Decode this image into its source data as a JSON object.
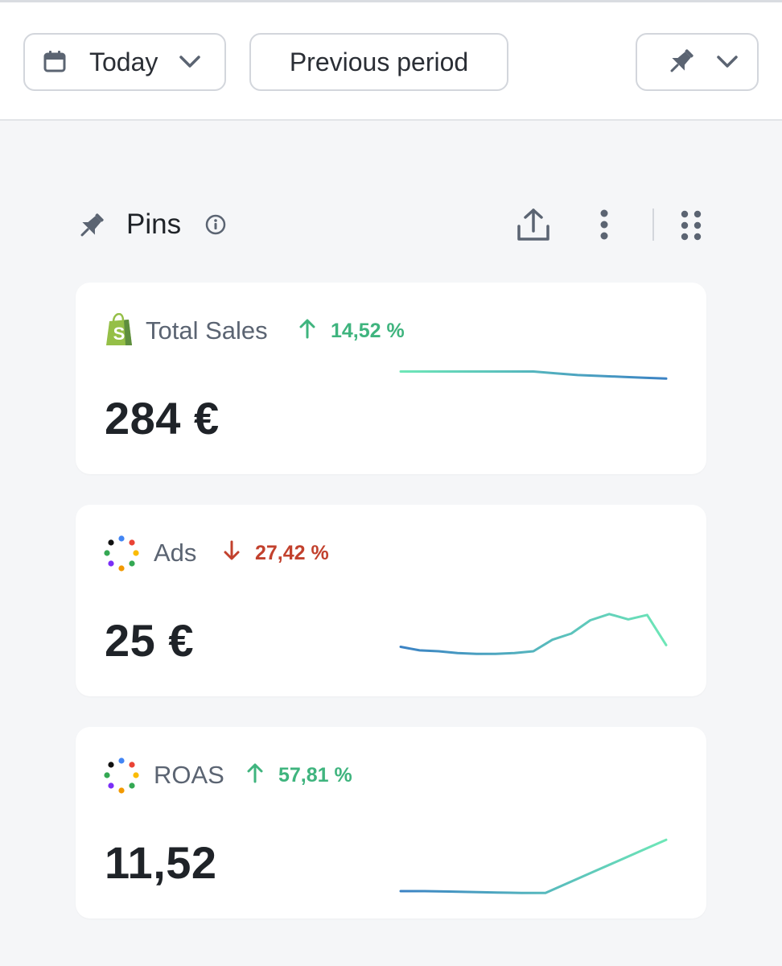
{
  "toolbar": {
    "date_label": "Today",
    "compare_label": "Previous period"
  },
  "section": {
    "title": "Pins"
  },
  "cards": [
    {
      "name": "Total Sales",
      "change": "14,52 %",
      "trend": "up",
      "value": "284 €",
      "icon": "shopify-icon",
      "sparkline": [
        0.95,
        0.95,
        0.95,
        0.95,
        0.95,
        0.95,
        0.95,
        0.93,
        0.91,
        0.9,
        0.89,
        0.88,
        0.87
      ],
      "colors": [
        "#6ee7b7",
        "#3b82c4"
      ]
    },
    {
      "name": "Ads",
      "change": "27,42 %",
      "trend": "down",
      "value": "25 €",
      "icon": "ads-dots-icon",
      "sparkline": [
        0.35,
        0.31,
        0.3,
        0.28,
        0.27,
        0.27,
        0.28,
        0.3,
        0.43,
        0.5,
        0.65,
        0.72,
        0.66,
        0.71,
        0.37
      ],
      "colors": [
        "#3b82c4",
        "#6ee7b7"
      ]
    },
    {
      "name": "ROAS",
      "change": "57,81 %",
      "trend": "up",
      "value": "11,52",
      "icon": "ads-dots-icon",
      "sparkline": [
        0.1,
        0.1,
        0.095,
        0.09,
        0.085,
        0.08,
        0.08,
        0.2,
        0.32,
        0.44,
        0.56,
        0.68
      ],
      "colors": [
        "#3b82c4",
        "#6ee7b7"
      ]
    }
  ],
  "colors": {
    "up": "#3fb47e",
    "down": "#c2412d",
    "text_muted": "#5b6472",
    "icon": "#5b6472"
  }
}
